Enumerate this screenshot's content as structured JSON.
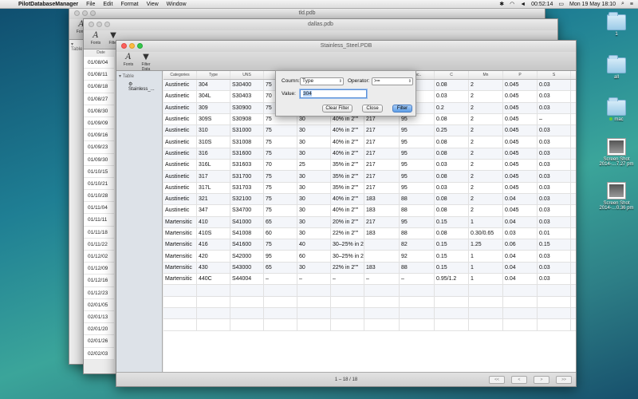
{
  "menubar": {
    "app_name": "PilotDatabaseManager",
    "items": [
      "File",
      "Edit",
      "Format",
      "View",
      "Window"
    ],
    "clock": "00:52:14",
    "date_time": "Mon 19 May  18:10"
  },
  "desktop": [
    {
      "label": "1",
      "kind": "folder"
    },
    {
      "label": "all",
      "kind": "folder"
    },
    {
      "label": "mac",
      "kind": "folder"
    },
    {
      "label": "Screen Shot 2014-…7.27 pm",
      "kind": "screenshot"
    },
    {
      "label": "Screen Shot 2014-…0.36 pm",
      "kind": "screenshot"
    }
  ],
  "windows": {
    "back": {
      "title": "tld.pdb",
      "toolbar": [
        "Fonts",
        "Filter"
      ],
      "sidebar": "Table",
      "col_header": "Date",
      "dates": [
        "01/08/04",
        "01/08/11",
        "01/08/18",
        "01/08/27",
        "01/08/30",
        "01/09/09",
        "01/09/16",
        "01/09/23",
        "01/09/30",
        "01/10/15",
        "01/10/21",
        "01/10/28",
        "01/11/04",
        "01/11/11",
        "01/11/18",
        "01/11/22",
        "01/12/02",
        "01/12/09",
        "01/12/16",
        "01/12/23",
        "02/01/05",
        "02/01/13",
        "02/01/20",
        "02/01/26",
        "02/02/03"
      ]
    },
    "middle": {
      "title": "dallas.pdb"
    },
    "front": {
      "title": "Stainless_Steel.PDB",
      "toolbar": [
        "Fonts",
        "Filter Data"
      ],
      "sidebar_group": "Table",
      "sidebar_item": "Stainless_...",
      "status": "1 – 18 / 18",
      "pager": [
        "<<",
        "<",
        ">",
        ">>"
      ]
    }
  },
  "table": {
    "columns": [
      "Categories",
      "Type",
      "UNS",
      "",
      "",
      "",
      "",
      "Roc..",
      "C",
      "Mn",
      "P",
      "S"
    ],
    "rows": [
      [
        "Austinetic",
        "304",
        "S30400",
        "75",
        "30",
        "40% in 2\"\"",
        "217",
        "95",
        "0.08",
        "2",
        "0.045",
        "0.03"
      ],
      [
        "Austinetic",
        "304L",
        "S30403",
        "70",
        "25",
        "40% in 2\"\"",
        "183",
        "88",
        "0.03",
        "2",
        "0.045",
        "0.03"
      ],
      [
        "Austinetic",
        "309",
        "S30900",
        "75",
        "30",
        "40% in 2\"\"",
        "217",
        "95",
        "0.2",
        "2",
        "0.045",
        "0.03"
      ],
      [
        "Austinetic",
        "309S",
        "S30908",
        "75",
        "30",
        "40% in 2\"\"",
        "217",
        "95",
        "0.08",
        "2",
        "0.045",
        "–"
      ],
      [
        "Austinetic",
        "310",
        "S31000",
        "75",
        "30",
        "40% in 2\"\"",
        "217",
        "95",
        "0.25",
        "2",
        "0.045",
        "0.03"
      ],
      [
        "Austinetic",
        "310S",
        "S31008",
        "75",
        "30",
        "40% in 2\"\"",
        "217",
        "95",
        "0.08",
        "2",
        "0.045",
        "0.03"
      ],
      [
        "Austinetic",
        "316",
        "S31600",
        "75",
        "30",
        "40% in 2\"\"",
        "217",
        "95",
        "0.08",
        "2",
        "0.045",
        "0.03"
      ],
      [
        "Austinetic",
        "316L",
        "S31603",
        "70",
        "25",
        "35% in 2\"\"",
        "217",
        "95",
        "0.03",
        "2",
        "0.045",
        "0.03"
      ],
      [
        "Austinetic",
        "317",
        "S31700",
        "75",
        "30",
        "35% in 2\"\"",
        "217",
        "95",
        "0.08",
        "2",
        "0.045",
        "0.03"
      ],
      [
        "Austinetic",
        "317L",
        "S31703",
        "75",
        "30",
        "35% in 2\"\"",
        "217",
        "95",
        "0.03",
        "2",
        "0.045",
        "0.03"
      ],
      [
        "Austinetic",
        "321",
        "S32100",
        "75",
        "30",
        "40% in 2\"\"",
        "183",
        "88",
        "0.08",
        "2",
        "0.04",
        "0.03"
      ],
      [
        "Austinetic",
        "347",
        "S34700",
        "75",
        "30",
        "40% in 2\"\"",
        "183",
        "88",
        "0.08",
        "2",
        "0.045",
        "0.03"
      ],
      [
        "Martensitic",
        "410",
        "S41000",
        "65",
        "30",
        "20% in 2\"\"",
        "217",
        "95",
        "0.15",
        "1",
        "0.04",
        "0.03"
      ],
      [
        "Martensitic",
        "410S",
        "S41008",
        "60",
        "30",
        "22% in 2\"\"",
        "183",
        "88",
        "0.08",
        "0.30/0.65",
        "0.03",
        "0.01"
      ],
      [
        "Martensitic",
        "416",
        "S41600",
        "75",
        "40",
        "30–25% in 2\"\"",
        "",
        "82",
        "0.15",
        "1.25",
        "0.06",
        "0.15"
      ],
      [
        "Martensitic",
        "420",
        "S42000",
        "95",
        "60",
        "30–25% in 2\"\"",
        "",
        "92",
        "0.15",
        "1",
        "0.04",
        "0.03"
      ],
      [
        "Martensitic",
        "430",
        "S43000",
        "65",
        "30",
        "22% in 2\"\"",
        "183",
        "88",
        "0.15",
        "1",
        "0.04",
        "0.03"
      ],
      [
        "Martensitic",
        "440C",
        "S44004",
        "–",
        "–",
        "–",
        "–",
        "–",
        "0.95/1.2",
        "1",
        "0.04",
        "0.03"
      ]
    ]
  },
  "filter": {
    "column_label": "Coumn:",
    "column_value": "Type",
    "operator_label": "Operator:",
    "operator_value": ">=",
    "value_label": "Value:",
    "value": "304",
    "clear_label": "Clear Filter",
    "close_label": "Close",
    "filter_label": "Filter"
  },
  "colors": {
    "accent": "#5d9ee8"
  }
}
